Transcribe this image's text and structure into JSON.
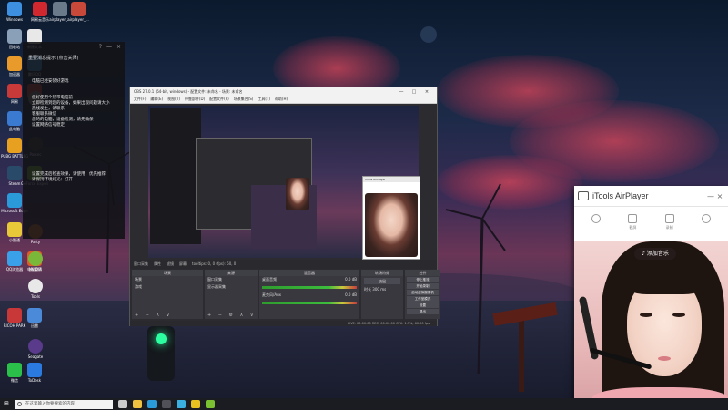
{
  "desktop": {
    "icons": [
      {
        "label": "Windows",
        "color": "#3d8fe0"
      },
      {
        "label": "网易云音乐",
        "color": "#d0282e"
      },
      {
        "label": "airplayer_...",
        "color": "#6a7a8a"
      },
      {
        "label": "airplayer_...",
        "color": "#c8483a"
      },
      {
        "label": "回收站",
        "color": "#8aa0b8"
      },
      {
        "label": "新建文本",
        "color": "#e8e8e8"
      },
      {
        "label": "加速器",
        "color": "#e89a2a"
      },
      {
        "label": "腾讯QQ",
        "color": "#3a9ae0"
      },
      {
        "label": "网易",
        "color": "#c83a3a"
      },
      {
        "label": "客户端",
        "color": "#d84040"
      },
      {
        "label": "此电脑",
        "color": "#3a7ad0"
      },
      {
        "label": "PUBG BATTLEGR...",
        "color": "#e8a020"
      },
      {
        "label": "Steam",
        "color": "#2a4a6a"
      },
      {
        "label": "GeForce Experience",
        "color": "#7ab83a"
      },
      {
        "label": "Microsoft Edge",
        "color": "#2a9ad8"
      },
      {
        "label": "小鹅通",
        "color": "#e8c838"
      },
      {
        "label": "QQ浏览器",
        "color": "#3aa0e8"
      },
      {
        "label": "电脑管家",
        "color": "#e05a2a"
      },
      {
        "label": "RICOH PARK",
        "color": "#c83838"
      },
      {
        "label": "迅雷",
        "color": "#4a8ad8"
      },
      {
        "label": "微信",
        "color": "#2ac04a"
      },
      {
        "label": "ToDesk",
        "color": "#2a7ae0"
      }
    ],
    "side_icons": [
      {
        "label": "OBS",
        "color": "#888"
      },
      {
        "label": "Parsec",
        "color": "#444"
      },
      {
        "label": "Party",
        "color": "#e07030"
      },
      {
        "label": "NVIDIA",
        "color": "#7ab83a"
      },
      {
        "label": "Tools",
        "color": "#e8e8e8"
      },
      {
        "label": "Seagate",
        "color": "#5a3a8a"
      }
    ]
  },
  "notification": {
    "top_row": "重要消息提示 (点击关闭)",
    "header_line": "电脑已经安装好游戏",
    "lines": [
      "您好使用个热带电脑前",
      "立即检测到您的设备，如果出现问题请大小",
      "热线发生，请联系",
      "客服联系微信",
      "您的的电脑，设备检测，请先确保",
      "设置网络信号稳定"
    ],
    "footer_lines": [
      "设置完成后检查效果，请使用，优先推荐",
      "请保持环境灯光：打开"
    ]
  },
  "obs": {
    "title": "OBS 27.0.1 (64-bit, windows) - 配置文件: 未命名 - 场景: 未命名",
    "menu": [
      "文件(F)",
      "编辑(E)",
      "视图(V)",
      "停靠部件(D)",
      "配置文件(P)",
      "场景集合(S)",
      "工具(T)",
      "帮助(H)"
    ],
    "status_labels": [
      "窗口采集",
      "属性",
      "滤镜",
      "屏幕",
      "tooltips: 0, 0 (fps): 60, 0"
    ],
    "docks": {
      "scenes_title": "场景",
      "scenes": [
        "场景",
        "游戏"
      ],
      "sources_title": "来源",
      "sources": [
        "窗口采集",
        "显示器采集"
      ],
      "mixer_title": "混音器",
      "mixer_tracks": [
        {
          "name": "桌面音频",
          "db": "0.0 dB"
        },
        {
          "name": "麦克风/Aux",
          "db": "0.0 dB"
        }
      ],
      "transitions_title": "转场特效",
      "transition_value": "淡出",
      "duration_label": "时长",
      "duration_value": "300 ms",
      "controls_title": "控件",
      "controls": [
        "停止推流",
        "开始录制",
        "启动虚拟摄像机",
        "工作室模式",
        "设置",
        "退出"
      ]
    },
    "footer": "LIVE: 00:00:00   REC: 00:00:00   CPU: 1.3%, 60.00 fps"
  },
  "preview_mini_window": {
    "title": "iTools AirPlayer"
  },
  "airplayer": {
    "title": "iTools AirPlayer",
    "minimize": "—",
    "close": "×",
    "tools": [
      {
        "icon": "rotate-icon",
        "label": ""
      },
      {
        "icon": "screenshot-icon",
        "label": "截屏"
      },
      {
        "icon": "record-icon",
        "label": "录制"
      },
      {
        "icon": "fullscreen-icon",
        "label": ""
      }
    ],
    "music_badge": "♪ 添加音乐"
  },
  "taskbar": {
    "search_placeholder": "在这里输入你要搜索的内容",
    "apps": [
      {
        "name": "task-view",
        "color": "#cccccc"
      },
      {
        "name": "file-explorer",
        "color": "#f0c040"
      },
      {
        "name": "edge",
        "color": "#2a9ad8"
      },
      {
        "name": "obs",
        "color": "#505058"
      },
      {
        "name": "itools",
        "color": "#3ab0e0"
      },
      {
        "name": "wechat",
        "color": "#e8c020"
      },
      {
        "name": "qq",
        "color": "#7ac030"
      }
    ]
  }
}
